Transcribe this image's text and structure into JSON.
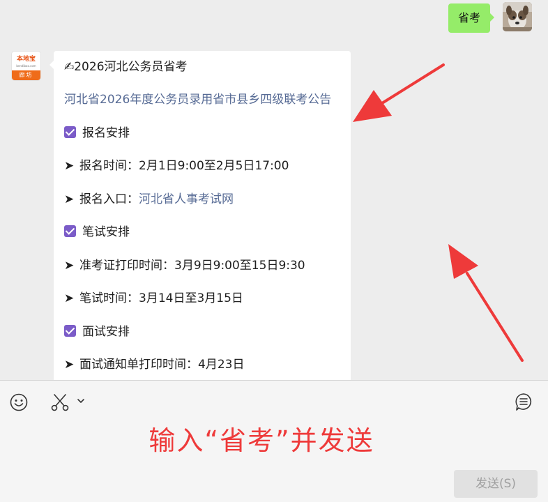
{
  "outgoing": {
    "text": "省考"
  },
  "incoming": {
    "avatar": {
      "name": "本地宝",
      "domain": "bendibao.com",
      "city": "廊坊"
    },
    "title": "✍2026河北公务员省考",
    "link": "河北省2026年度公务员录用省市县乡四级联考公告",
    "sections": {
      "registration": {
        "heading": "报名安排",
        "time_label": "报名时间：",
        "time_value": "2月1日9:00至2月5日17:00",
        "entry_label": "报名入口：",
        "entry_link": "河北省人事考试网"
      },
      "written": {
        "heading": "笔试安排",
        "admit_label": "准考证打印时间：",
        "admit_value": "3月9日9:00至15日9:30",
        "exam_label": "笔试时间：",
        "exam_value": "3月14日至3月15日"
      },
      "interview": {
        "heading": "面试安排",
        "notice_label": "面试通知单打印时间：",
        "notice_value": "4月23日"
      }
    },
    "bullet": "➤"
  },
  "instruction": "输入“省考”并发送",
  "send_button": "发送(S)",
  "icons": {
    "emoji": "emoji-icon",
    "scissors": "scissors-icon",
    "chevron": "chevron-down-icon",
    "history": "chat-history-icon",
    "checkbox": "checkbox-icon"
  },
  "colors": {
    "chat_bg": "#ededed",
    "outgoing_bubble": "#95ec69",
    "link": "#576b95",
    "checkbox": "#7b5cc8",
    "annotation": "#ee3a3a",
    "send_button_bg": "#e1e1e1"
  }
}
